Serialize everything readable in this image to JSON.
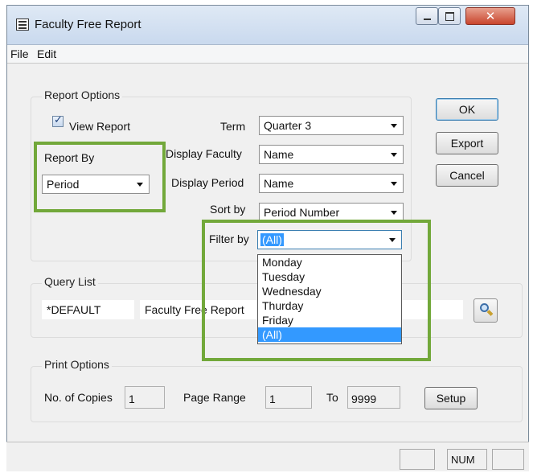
{
  "window": {
    "title": "Faculty Free Report",
    "close_glyph": "✕"
  },
  "menu": {
    "items": [
      "File",
      "Edit"
    ]
  },
  "report_options": {
    "group_label": "Report Options",
    "view_report_label": "View Report",
    "view_report_checked": true,
    "report_by_label": "Report By",
    "report_by_value": "Period",
    "term_label": "Term",
    "term_value": "Quarter 3",
    "display_faculty_label": "Display Faculty",
    "display_faculty_value": "Name",
    "display_period_label": "Display Period",
    "display_period_value": "Name",
    "sort_by_label": "Sort by",
    "sort_by_value": "Period Number",
    "filter_by_label": "Filter by",
    "filter_by_value": "(All)",
    "filter_options": [
      "Monday",
      "Tuesday",
      "Wednesday",
      "Thurday",
      "Friday",
      "(All)"
    ],
    "filter_selected": "(All)"
  },
  "buttons": {
    "ok": "OK",
    "export": "Export",
    "cancel": "Cancel",
    "setup": "Setup"
  },
  "query_list": {
    "group_label": "Query List",
    "query_name": "*DEFAULT",
    "query_description": "Faculty Free Report"
  },
  "print_options": {
    "group_label": "Print Options",
    "copies_label": "No. of Copies",
    "copies_value": "1",
    "page_range_label": "Page Range",
    "page_from": "1",
    "to_label": "To",
    "page_to": "9999"
  },
  "status_bar": {
    "num_indicator": "NUM"
  },
  "colors": {
    "highlight_green": "#72a83a",
    "selection_blue": "#3399ff"
  },
  "icons": {
    "search": "magnifier-icon",
    "app": "report-window-icon"
  }
}
